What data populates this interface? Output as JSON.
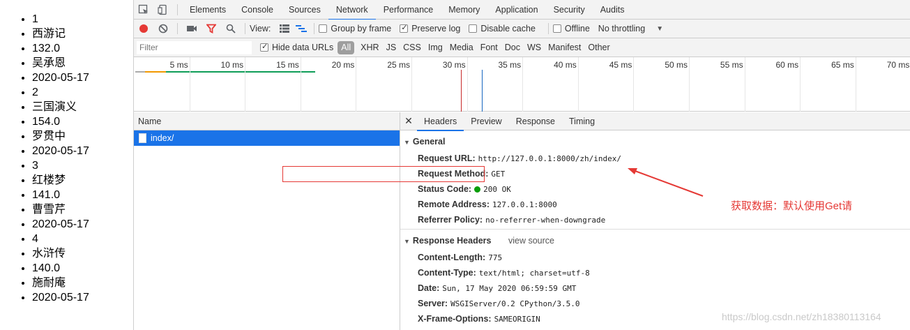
{
  "page_list": [
    "1",
    "西游记",
    "132.0",
    "吴承恩",
    "2020-05-17",
    "2",
    "三国演义",
    "154.0",
    "罗贯中",
    "2020-05-17",
    "3",
    "红楼梦",
    "141.0",
    "曹雪芹",
    "2020-05-17",
    "4",
    "水浒传",
    "140.0",
    "施耐庵",
    "2020-05-17"
  ],
  "devtools": {
    "tabs": [
      "Elements",
      "Console",
      "Sources",
      "Network",
      "Performance",
      "Memory",
      "Application",
      "Security",
      "Audits"
    ],
    "active_tab": "Network",
    "controls": {
      "view_label": "View:",
      "group_by_frame": "Group by frame",
      "preserve_log": "Preserve log",
      "disable_cache": "Disable cache",
      "offline": "Offline",
      "throttling": "No throttling"
    },
    "filter": {
      "placeholder": "Filter",
      "hide_data_urls": "Hide data URLs",
      "types": [
        "All",
        "XHR",
        "JS",
        "CSS",
        "Img",
        "Media",
        "Font",
        "Doc",
        "WS",
        "Manifest",
        "Other"
      ]
    },
    "timeline_ticks": [
      "5 ms",
      "10 ms",
      "15 ms",
      "20 ms",
      "25 ms",
      "30 ms",
      "35 ms",
      "40 ms",
      "45 ms",
      "50 ms",
      "55 ms",
      "60 ms",
      "65 ms",
      "70 ms"
    ],
    "request_list": {
      "header": "Name",
      "rows": [
        "index/"
      ]
    },
    "detail_tabs": [
      "Headers",
      "Preview",
      "Response",
      "Timing"
    ],
    "general": {
      "title": "General",
      "request_url_key": "Request URL:",
      "request_url": "http://127.0.0.1:8000/zh/index/",
      "request_method_key": "Request Method:",
      "request_method": "GET",
      "status_code_key": "Status Code:",
      "status_code": "200 OK",
      "remote_address_key": "Remote Address:",
      "remote_address": "127.0.0.1:8000",
      "referrer_policy_key": "Referrer Policy:",
      "referrer_policy": "no-referrer-when-downgrade"
    },
    "response_headers": {
      "title": "Response Headers",
      "view_source": "view source",
      "items": [
        {
          "k": "Content-Length:",
          "v": "775"
        },
        {
          "k": "Content-Type:",
          "v": "text/html; charset=utf-8"
        },
        {
          "k": "Date:",
          "v": "Sun, 17 May 2020 06:59:59 GMT"
        },
        {
          "k": "Server:",
          "v": "WSGIServer/0.2 CPython/3.5.0"
        },
        {
          "k": "X-Frame-Options:",
          "v": "SAMEORIGIN"
        }
      ]
    }
  },
  "annotation": "获取数据：默认使用Get请",
  "watermark": "https://blog.csdn.net/zh18380113164",
  "colors": {
    "accent": "#1a73e8",
    "annotation": "#e53935",
    "record": "#e53935",
    "status_ok": "#0a9d0a"
  }
}
